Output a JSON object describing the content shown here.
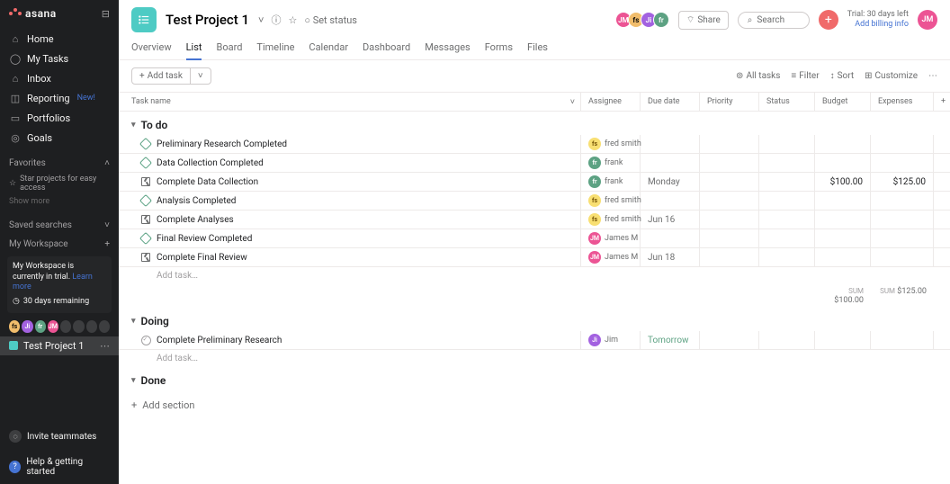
{
  "brand": "asana",
  "sidebar": {
    "nav": [
      {
        "label": "Home",
        "icon": "home"
      },
      {
        "label": "My Tasks",
        "icon": "check-circle"
      },
      {
        "label": "Inbox",
        "icon": "bell"
      },
      {
        "label": "Reporting",
        "icon": "chart",
        "badge": "New!"
      },
      {
        "label": "Portfolios",
        "icon": "folder"
      },
      {
        "label": "Goals",
        "icon": "target"
      }
    ],
    "favorites_label": "Favorites",
    "star_hint": "Star projects for easy access",
    "show_more": "Show more",
    "saved_searches": "Saved searches",
    "workspace": "My Workspace",
    "trial": {
      "line1": "My Workspace is currently in trial.",
      "learn": "Learn more",
      "remaining": "30 days remaining"
    },
    "project": {
      "name": "Test Project 1"
    },
    "invite": "Invite teammates",
    "help": "Help & getting started"
  },
  "header": {
    "title": "Test Project 1",
    "set_status": "Set status",
    "share": "Share",
    "search_placeholder": "Search",
    "trial_days": "Trial: 30 days left",
    "billing": "Add billing info",
    "me": "JM",
    "people": [
      {
        "txt": "JM",
        "cls": "av-pk"
      },
      {
        "txt": "fs",
        "cls": "av-y"
      },
      {
        "txt": "Ji",
        "cls": "av-p"
      },
      {
        "txt": "fr",
        "cls": "av-g"
      }
    ]
  },
  "tabs": [
    "Overview",
    "List",
    "Board",
    "Timeline",
    "Calendar",
    "Dashboard",
    "Messages",
    "Forms",
    "Files"
  ],
  "active_tab": "List",
  "toolbar": {
    "add_task": "Add task",
    "all_tasks": "All tasks",
    "filter": "Filter",
    "sort": "Sort",
    "customize": "Customize"
  },
  "columns": {
    "name": "Task name",
    "assignee": "Assignee",
    "due": "Due date",
    "priority": "Priority",
    "status": "Status",
    "budget": "Budget",
    "expenses": "Expenses"
  },
  "sections": [
    {
      "name": "To do",
      "rows": [
        {
          "kind": "milestone",
          "name": "Preliminary Research Completed",
          "assignee": {
            "txt": "fs",
            "cls": "rv-y",
            "name": "fred smith"
          }
        },
        {
          "kind": "milestone",
          "name": "Data Collection Completed",
          "assignee": {
            "txt": "fr",
            "cls": "rv-g",
            "name": "frank"
          }
        },
        {
          "kind": "approval",
          "name": "Complete Data Collection",
          "assignee": {
            "txt": "fr",
            "cls": "rv-g",
            "name": "frank"
          },
          "due": "Monday",
          "budget": "$100.00",
          "expenses": "$125.00"
        },
        {
          "kind": "milestone",
          "name": "Analysis Completed",
          "assignee": {
            "txt": "fs",
            "cls": "rv-y",
            "name": "fred smith"
          }
        },
        {
          "kind": "approval",
          "name": "Complete Analyses",
          "assignee": {
            "txt": "fs",
            "cls": "rv-y",
            "name": "fred smith"
          },
          "due": "Jun 16"
        },
        {
          "kind": "milestone",
          "name": "Final Review Completed",
          "assignee": {
            "txt": "JM",
            "cls": "rv-p",
            "name": "James M"
          }
        },
        {
          "kind": "approval",
          "name": "Complete Final Review",
          "assignee": {
            "txt": "JM",
            "cls": "rv-p",
            "name": "James M"
          },
          "due": "Jun 18"
        }
      ],
      "sum": {
        "budget": "$100.00",
        "expenses": "$125.00",
        "label": "SUM"
      }
    },
    {
      "name": "Doing",
      "rows": [
        {
          "kind": "task",
          "name": "Complete Preliminary Research",
          "assignee": {
            "txt": "Ji",
            "cls": "rv-b",
            "name": "Jim"
          },
          "due": "Tomorrow",
          "due_cls": "due-tom"
        }
      ]
    },
    {
      "name": "Done",
      "rows": []
    }
  ],
  "add_task_placeholder": "Add task…",
  "add_section": "Add section"
}
